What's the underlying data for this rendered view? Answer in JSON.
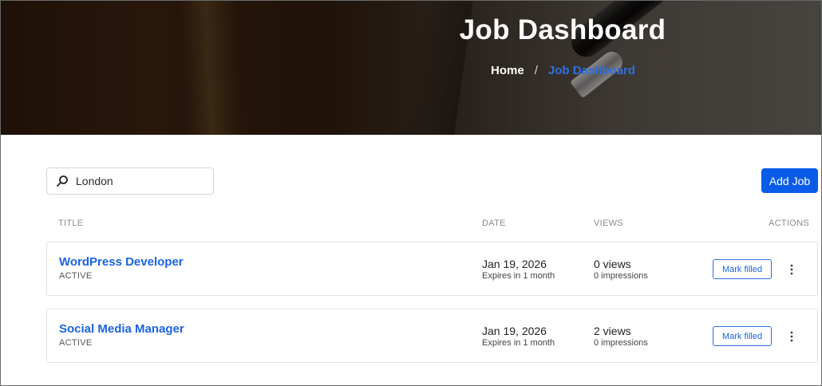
{
  "hero": {
    "title": "Job Dashboard",
    "breadcrumb": {
      "home": "Home",
      "separator": "/",
      "current": "Job Dashboard"
    }
  },
  "toolbar": {
    "search_value": "London",
    "search_icon": "search-icon",
    "add_job_label": "Add Job"
  },
  "table": {
    "headers": {
      "title": "TITLE",
      "date": "DATE",
      "views": "VIEWS",
      "actions": "ACTIONS"
    },
    "rows": [
      {
        "title": "WordPress Developer",
        "status": "ACTIVE",
        "date": "Jan 19, 2026",
        "expires": "Expires in 1 month",
        "views": "0 views",
        "impressions": "0 impressions",
        "action_label": "Mark filled",
        "more_icon": "more-vertical-icon"
      },
      {
        "title": "Social Media Manager",
        "status": "ACTIVE",
        "date": "Jan 19, 2026",
        "expires": "Expires in 1 month",
        "views": "2 views",
        "impressions": "0 impressions",
        "action_label": "Mark filled",
        "more_icon": "more-vertical-icon"
      }
    ]
  },
  "colors": {
    "accent": "#0a5ce8",
    "link": "#1b63e0",
    "breadcrumb_current": "#2f6fe0"
  }
}
